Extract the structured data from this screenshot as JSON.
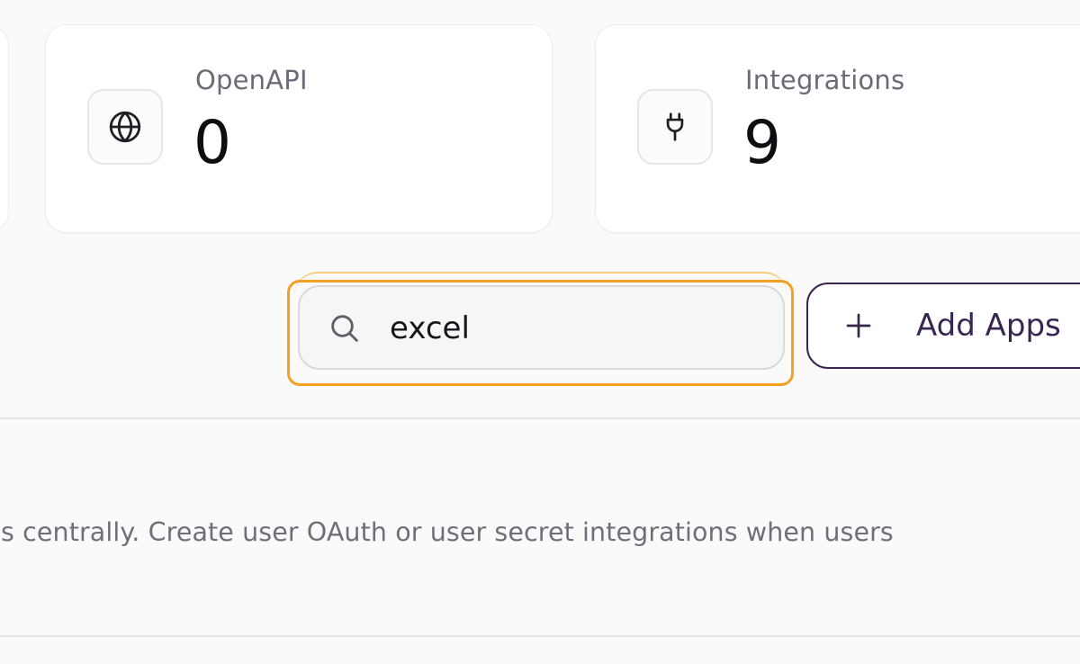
{
  "stats": [
    {
      "label": "OpenAPI",
      "value": "0",
      "icon": "globe-icon"
    },
    {
      "label": "Integrations",
      "value": "9",
      "icon": "plug-icon"
    }
  ],
  "search": {
    "value": "excel",
    "placeholder": ""
  },
  "toolbar": {
    "add_apps_label": "Add Apps"
  },
  "description": "ntials centrally. Create user OAuth or user secret integrations when users",
  "colors": {
    "focus_ring": "#f5a024",
    "accent": "#3a2550",
    "muted_text": "#6b6b78"
  }
}
